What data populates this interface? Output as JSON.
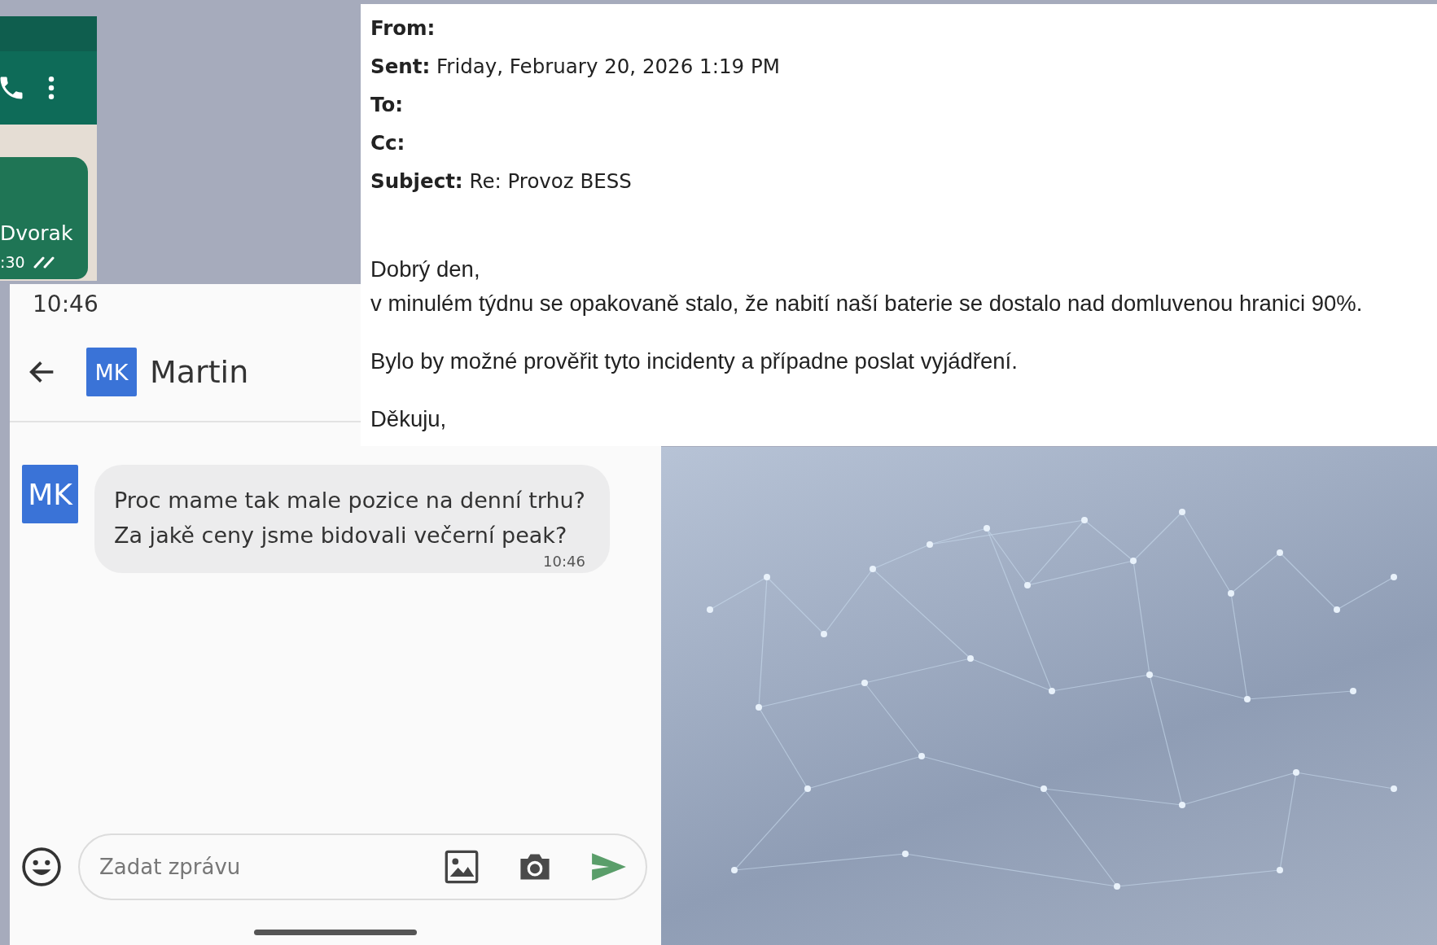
{
  "chat_fragment": {
    "bubble_text": "Dvorak",
    "bubble_time": ":30"
  },
  "email": {
    "headers": [
      {
        "label": "From:"
      },
      {
        "label": "Sent:",
        "value": "Friday, February 20, 2026 1:19 PM"
      },
      {
        "label": "To:"
      },
      {
        "label": "Cc:"
      },
      {
        "label": "Subject:",
        "value": "Re: Provoz BESS"
      }
    ],
    "paragraphs": [
      [
        "Dobrý den,",
        "v minulém týdnu se opakovaně stalo, že nabití naší baterie se dostalo nad domluvenou hranici 90%."
      ],
      [
        "Bylo by možné prověřit tyto incidenty a případne poslat vyjádření."
      ],
      [
        "Děkuju,"
      ]
    ]
  },
  "phone": {
    "status_time": "10:46",
    "contact": {
      "initials": "MK",
      "name": "Martin"
    },
    "messages": [
      {
        "initials": "MK",
        "lines": [
          "Proc mame tak male pozice na denní trhu?",
          "Za jakě ceny jsme bidovali večerní peak?"
        ],
        "time": "10:46"
      }
    ],
    "composer": {
      "placeholder": "Zadat zprávu"
    }
  }
}
